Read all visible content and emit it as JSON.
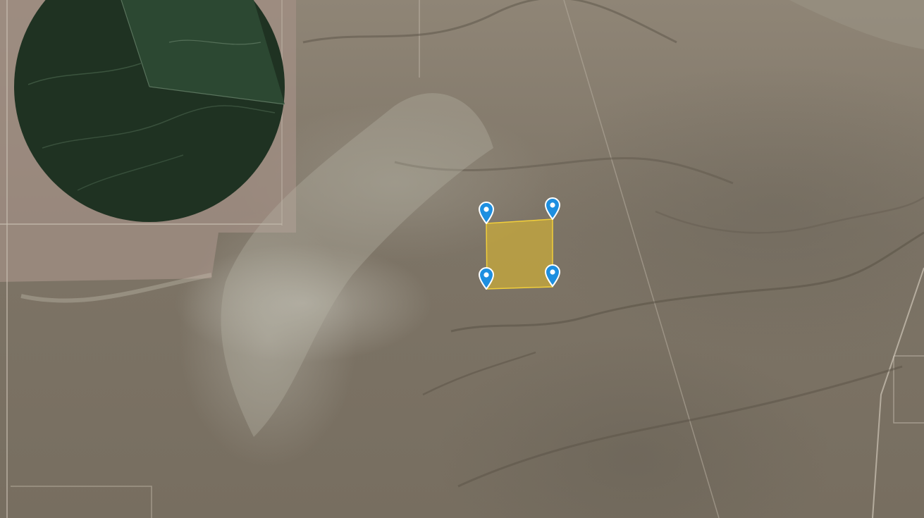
{
  "map": {
    "view": "satellite",
    "parcel": {
      "fill_color": "#e3bd2c",
      "stroke_color": "#f2cf3a",
      "corner_markers": 4
    },
    "marker": {
      "icon": "map-pin-icon",
      "color": "#1d8fe0"
    },
    "features": {
      "center_pivot_field_color": "#1f3222"
    }
  }
}
